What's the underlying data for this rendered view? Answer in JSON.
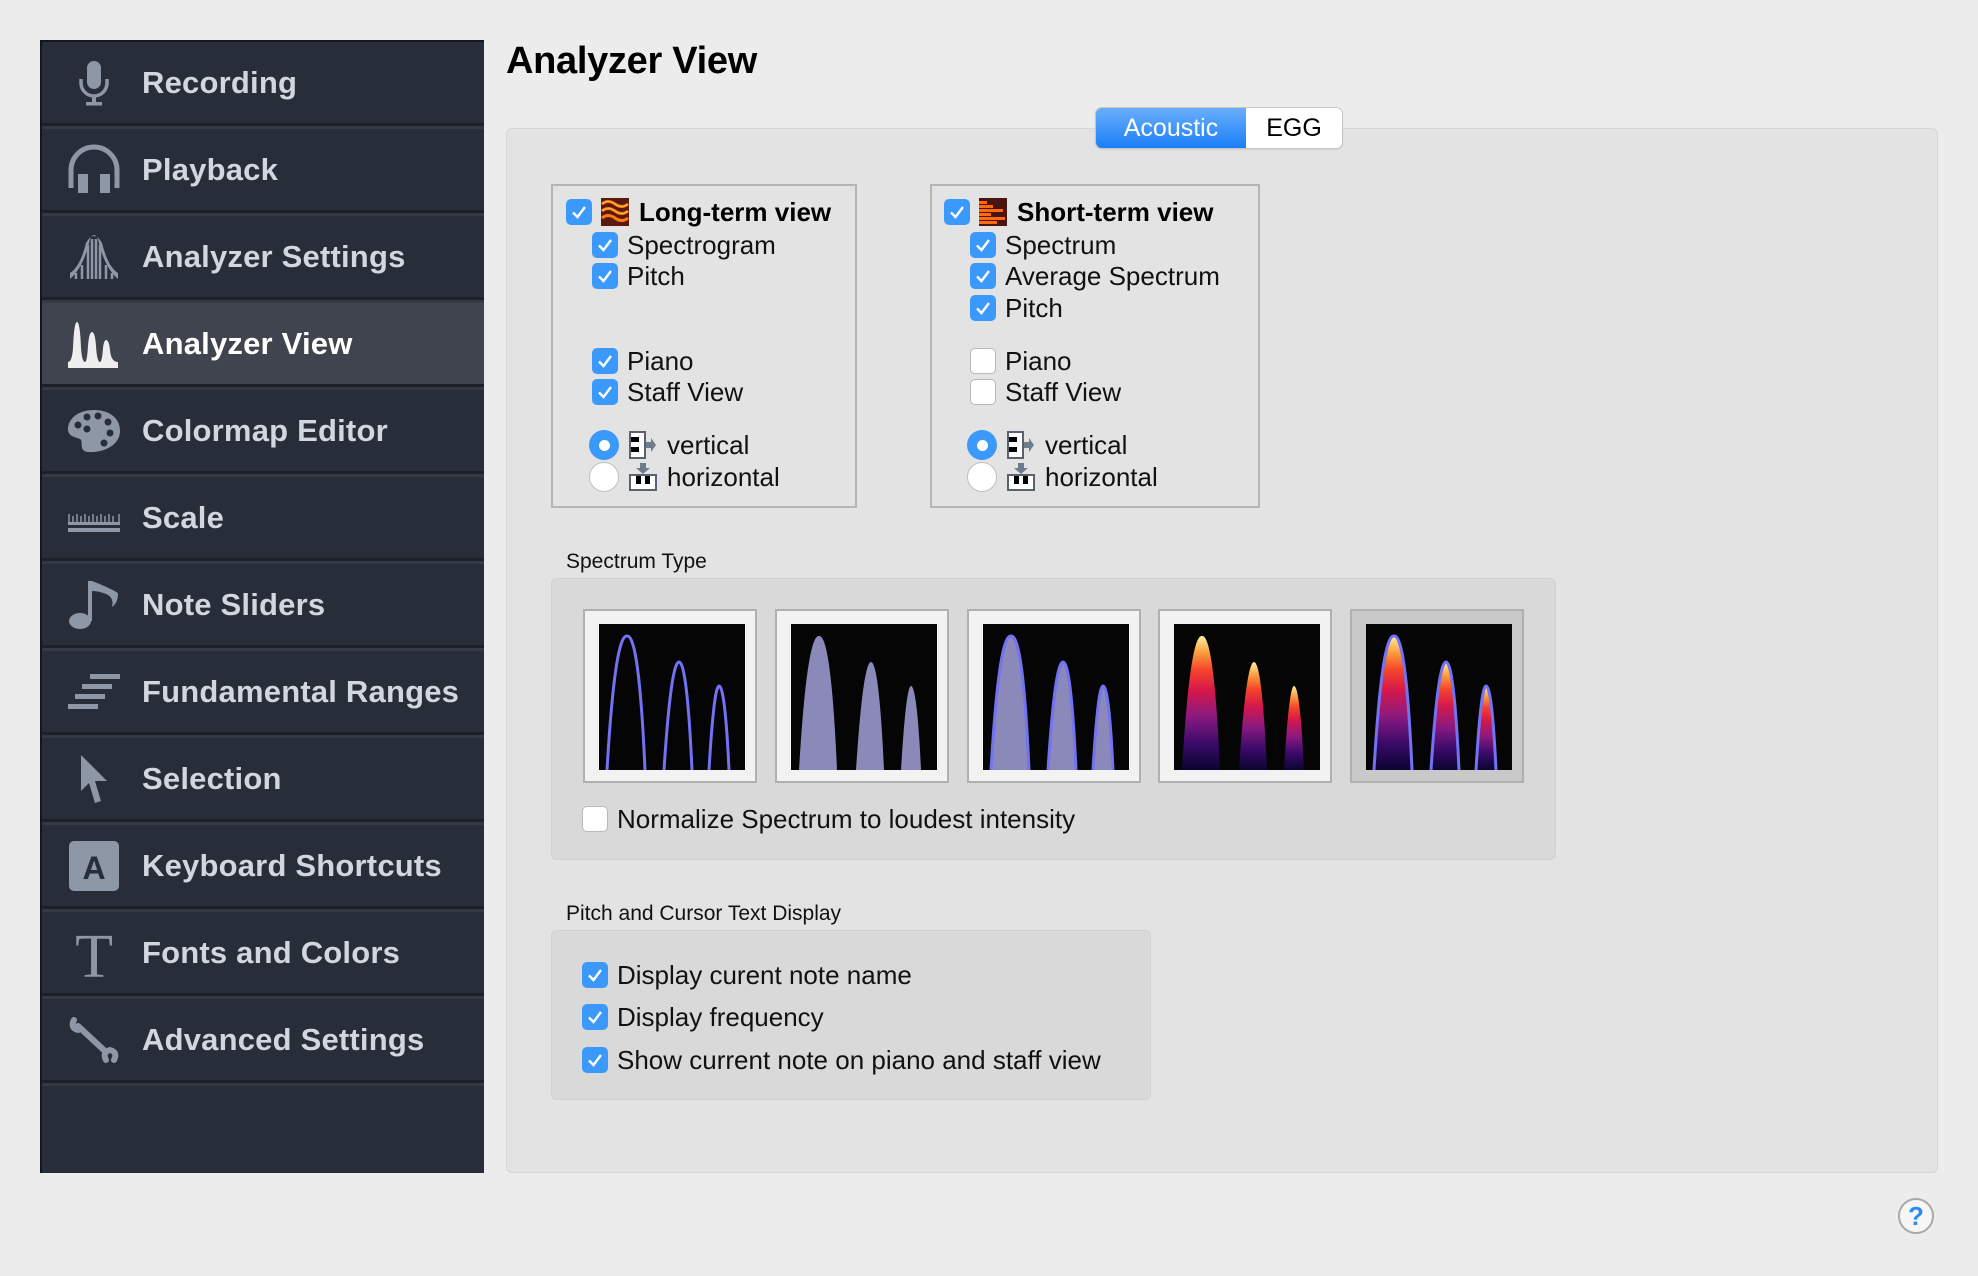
{
  "page_title": "Analyzer View",
  "sidebar": {
    "items": [
      {
        "label": "Recording",
        "icon": "microphone-icon",
        "selected": false
      },
      {
        "label": "Playback",
        "icon": "headphones-icon",
        "selected": false
      },
      {
        "label": "Analyzer Settings",
        "icon": "analyzer-settings-icon",
        "selected": false
      },
      {
        "label": "Analyzer View",
        "icon": "spectrum-peaks-icon",
        "selected": true
      },
      {
        "label": "Colormap Editor",
        "icon": "palette-icon",
        "selected": false
      },
      {
        "label": "Scale",
        "icon": "ruler-icon",
        "selected": false
      },
      {
        "label": "Note Sliders",
        "icon": "music-note-icon",
        "selected": false
      },
      {
        "label": "Fundamental Ranges",
        "icon": "ranges-icon",
        "selected": false
      },
      {
        "label": "Selection",
        "icon": "pointer-icon",
        "selected": false
      },
      {
        "label": "Keyboard Shortcuts",
        "icon": "key-a-icon",
        "selected": false
      },
      {
        "label": "Fonts and Colors",
        "icon": "font-t-icon",
        "selected": false
      },
      {
        "label": "Advanced Settings",
        "icon": "wrench-icon",
        "selected": false
      }
    ]
  },
  "tabs": [
    {
      "label": "Acoustic",
      "active": true
    },
    {
      "label": "EGG",
      "active": false
    }
  ],
  "long_term": {
    "title": "Long-term view",
    "enabled": true,
    "options": [
      {
        "label": "Spectrogram",
        "checked": true
      },
      {
        "label": "Pitch",
        "checked": true
      },
      {
        "label": "Piano",
        "checked": true
      },
      {
        "label": "Staff View",
        "checked": true
      }
    ],
    "orientation": [
      {
        "label": "vertical",
        "selected": true
      },
      {
        "label": "horizontal",
        "selected": false
      }
    ]
  },
  "short_term": {
    "title": "Short-term view",
    "enabled": true,
    "options": [
      {
        "label": "Spectrum",
        "checked": true
      },
      {
        "label": "Average Spectrum",
        "checked": true
      },
      {
        "label": "Pitch",
        "checked": true
      },
      {
        "label": "Piano",
        "checked": false
      },
      {
        "label": "Staff View",
        "checked": false
      }
    ],
    "orientation": [
      {
        "label": "vertical",
        "selected": true
      },
      {
        "label": "horizontal",
        "selected": false
      }
    ]
  },
  "spectrum_type": {
    "label": "Spectrum Type",
    "types": [
      {
        "name": "line",
        "selected": false
      },
      {
        "name": "filled",
        "selected": false
      },
      {
        "name": "filled-with-line",
        "selected": false
      },
      {
        "name": "colormap",
        "selected": false
      },
      {
        "name": "colormap-with-line",
        "selected": true
      }
    ],
    "normalize": {
      "label": "Normalize Spectrum to loudest intensity",
      "checked": false
    }
  },
  "pitch_cursor": {
    "label": "Pitch and Cursor Text Display",
    "options": [
      {
        "label": "Display curent note name",
        "checked": true
      },
      {
        "label": "Display frequency",
        "checked": true
      },
      {
        "label": "Show current note on piano and staff view",
        "checked": true
      }
    ]
  },
  "help": {
    "label": "?"
  },
  "colors": {
    "accent": "#3b99fc",
    "sidebar_bg": "#282d3a",
    "sidebar_selected": "#40444f",
    "spectrum_line": "#7070f0",
    "spectrum_fill": "#8a89ba"
  }
}
